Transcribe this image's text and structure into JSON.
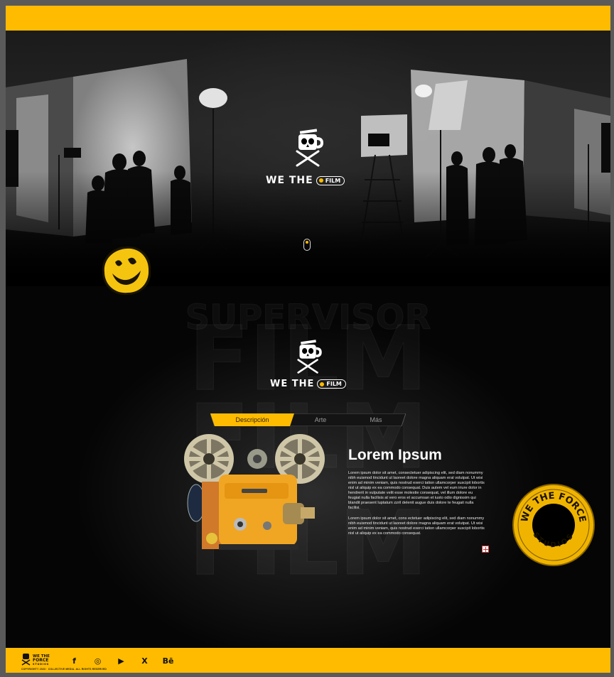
{
  "brand": {
    "logo_prefix": "WE THE",
    "logo_pill": "FILM",
    "footer_logo_line1": "WE THE",
    "footer_logo_line2": "FORCE",
    "footer_logo_line3": "STUDIOS"
  },
  "background_words": [
    "SUPERVISOR",
    "FILM",
    "FILM",
    "FILM"
  ],
  "tabs": [
    {
      "label": "Descripción",
      "active": true
    },
    {
      "label": "Arte",
      "active": false
    },
    {
      "label": "Más",
      "active": false
    }
  ],
  "content": {
    "title": "Lorem Ipsum",
    "paragraph_1": "Lorem ipsum dolor sit amet, consectetuer adipiscing elit, sed diam nonummy nibh euismod tincidunt ut laoreet dolore magna aliquam erat volutpat. Ut wisi enim ad minim veniam, quis nostrud exerci tation ullamcorper suscipit lobortis nisl ut aliquip ex ea commodo consequat. Duis autem vel eum iriure dolor in hendrerit in vulputate velit esse molestie consequat, vel illum dolore eu feugiat nulla facilisis at vero eros et accumsan et iusto odio dignissim qui blandit praesent luptatum zzril delenit augue duis dolore te feugait nulla facilisi.",
    "paragraph_2": "Lorem ipsum dolor sit amet, cons ectetuer adipiscing elit, sed diam nonummy nibh euismod tincidunt ut laoreet dolore magna aliquam erat volutpat. Ut wisi enim ad minim veniam, quis nostrud exerci tation ullamcorper suscipit lobortis nisl ut aliquip ex ea commodo consequat."
  },
  "badge": {
    "text_top": "WE THE FORCE",
    "text_bottom": "STUDIOS"
  },
  "footer": {
    "copyright": "COPYRIGHT© 2023 · COLLECTIVE MEDIA. ALL RIGHTS RESERVED",
    "socials": [
      {
        "name": "facebook-icon",
        "glyph": "f"
      },
      {
        "name": "instagram-icon",
        "glyph": "◎"
      },
      {
        "name": "youtube-icon",
        "glyph": "▶"
      },
      {
        "name": "x-twitter-icon",
        "glyph": "X"
      },
      {
        "name": "behance-icon",
        "glyph": "Bē"
      }
    ]
  },
  "colors": {
    "accent": "#ffbb00",
    "background": "#000000",
    "tab_active_text": "#2a1e00"
  }
}
